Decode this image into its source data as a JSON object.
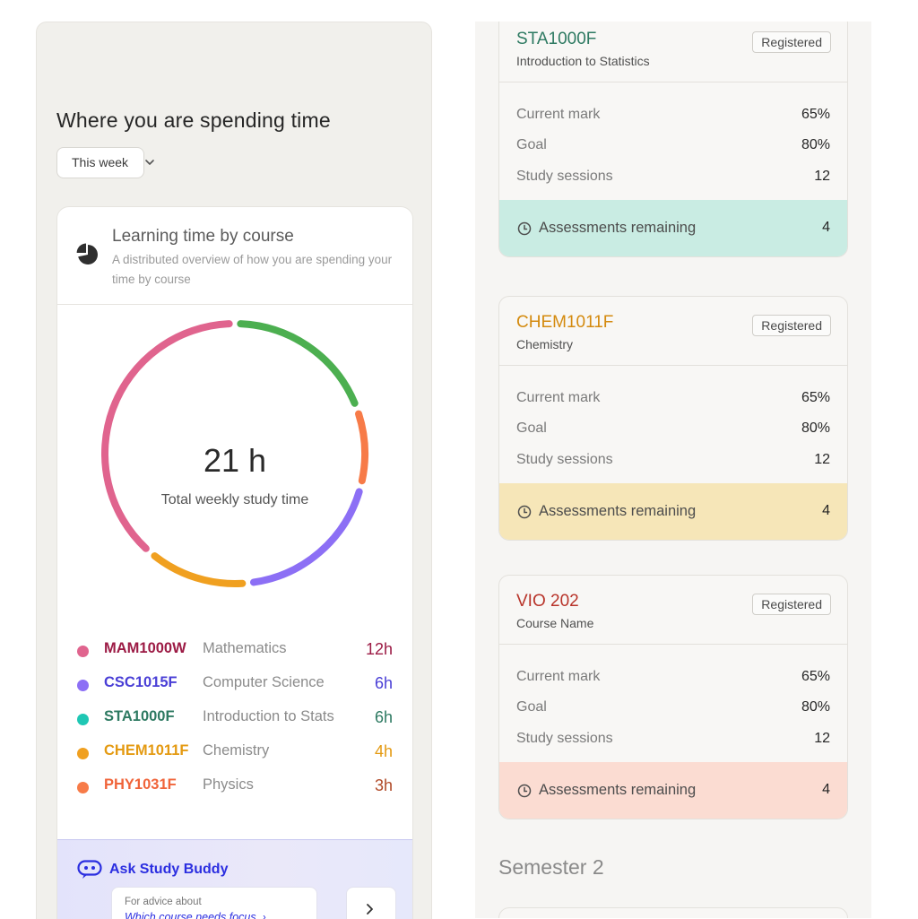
{
  "time_section": {
    "title": "Where you are spending time",
    "period_selected": "This week"
  },
  "chart_card": {
    "title": "Learning time by course",
    "subtitle": "A distributed overview of how you are spending your time by course",
    "total_value": "21 h",
    "total_label": "Total weekly study time"
  },
  "chart_data": {
    "type": "pie",
    "style": "donut",
    "total_hours": 21,
    "categories": [
      "MAM1000W",
      "CSC1015F",
      "STA1000F",
      "CHEM1011F",
      "PHY1031F"
    ],
    "values": [
      12,
      6,
      6,
      4,
      3
    ],
    "colors": [
      "#e0648e",
      "#8c6ff5",
      "#4caf50",
      "#f0a020",
      "#f77b48"
    ]
  },
  "legend": [
    {
      "code": "MAM1000W",
      "name": "Mathematics",
      "hours": "12h",
      "dot": "#e0648e",
      "code_color": "#9c1b45",
      "hours_color": "#9c1b45"
    },
    {
      "code": "CSC1015F",
      "name": "Computer Science",
      "hours": "6h",
      "dot": "#8c6ff5",
      "code_color": "#4a3fd6",
      "hours_color": "#4a3fd6"
    },
    {
      "code": "STA1000F",
      "name": "Introduction to Stats",
      "hours": "6h",
      "dot": "#1fc7b4",
      "code_color": "#2e7a62",
      "hours_color": "#2e7a62"
    },
    {
      "code": "CHEM1011F",
      "name": "Chemistry",
      "hours": "4h",
      "dot": "#f0a020",
      "code_color": "#e49a12",
      "hours_color": "#e49a12"
    },
    {
      "code": "PHY1031F",
      "name": "Physics",
      "hours": "3h",
      "dot": "#f77b48",
      "code_color": "#f0643a",
      "hours_color": "#b04a28"
    }
  ],
  "study_buddy": {
    "title": "Ask Study Buddy",
    "advice_label": "For advice about",
    "advice_question": "Which course needs focus"
  },
  "course_cards": [
    {
      "code": "STA1000F",
      "name": "Introduction to Statistics",
      "badge": "Registered",
      "code_color": "#2e7a62",
      "current_mark_label": "Current mark",
      "current_mark": "65%",
      "goal_label": "Goal",
      "goal": "80%",
      "sessions_label": "Study sessions",
      "sessions": "12",
      "assess_label": "Assessments remaining",
      "assess": "4",
      "assess_bg": "#c9ece3"
    },
    {
      "code": "CHEM1011F",
      "name": "Chemistry",
      "badge": "Registered",
      "code_color": "#d48a0e",
      "current_mark_label": "Current mark",
      "current_mark": "65%",
      "goal_label": "Goal",
      "goal": "80%",
      "sessions_label": "Study sessions",
      "sessions": "12",
      "assess_label": "Assessments remaining",
      "assess": "4",
      "assess_bg": "#f6e6b8"
    },
    {
      "code": "VIO 202",
      "name": "Course Name",
      "badge": "Registered",
      "code_color": "#b8342a",
      "current_mark_label": "Current mark",
      "current_mark": "65%",
      "goal_label": "Goal",
      "goal": "80%",
      "sessions_label": "Study sessions",
      "sessions": "12",
      "assess_label": "Assessments remaining",
      "assess": "4",
      "assess_bg": "#fbdcd2"
    }
  ],
  "semester2_title": "Semester 2"
}
